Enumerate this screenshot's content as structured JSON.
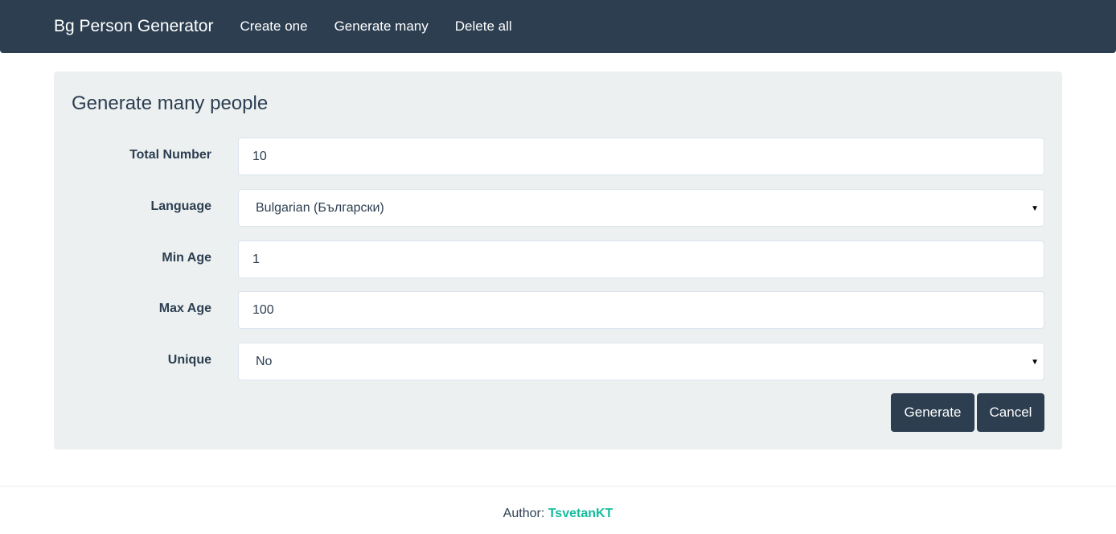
{
  "navbar": {
    "brand": "Bg Person Generator",
    "links": [
      "Create one",
      "Generate many",
      "Delete all"
    ]
  },
  "form": {
    "title": "Generate many people",
    "fields": {
      "total_number": {
        "label": "Total Number",
        "value": "10"
      },
      "language": {
        "label": "Language",
        "value": "Bulgarian (Български)"
      },
      "min_age": {
        "label": "Min Age",
        "value": "1"
      },
      "max_age": {
        "label": "Max Age",
        "value": "100"
      },
      "unique": {
        "label": "Unique",
        "value": "No"
      }
    },
    "generate_label": "Generate",
    "cancel_label": "Cancel"
  },
  "footer": {
    "author_prefix": "Author:",
    "author_name": "TsvetanKT"
  },
  "colors": {
    "navbar": "#2c3e50",
    "well": "#ecf0f1",
    "link_accent": "#18bc9c"
  }
}
